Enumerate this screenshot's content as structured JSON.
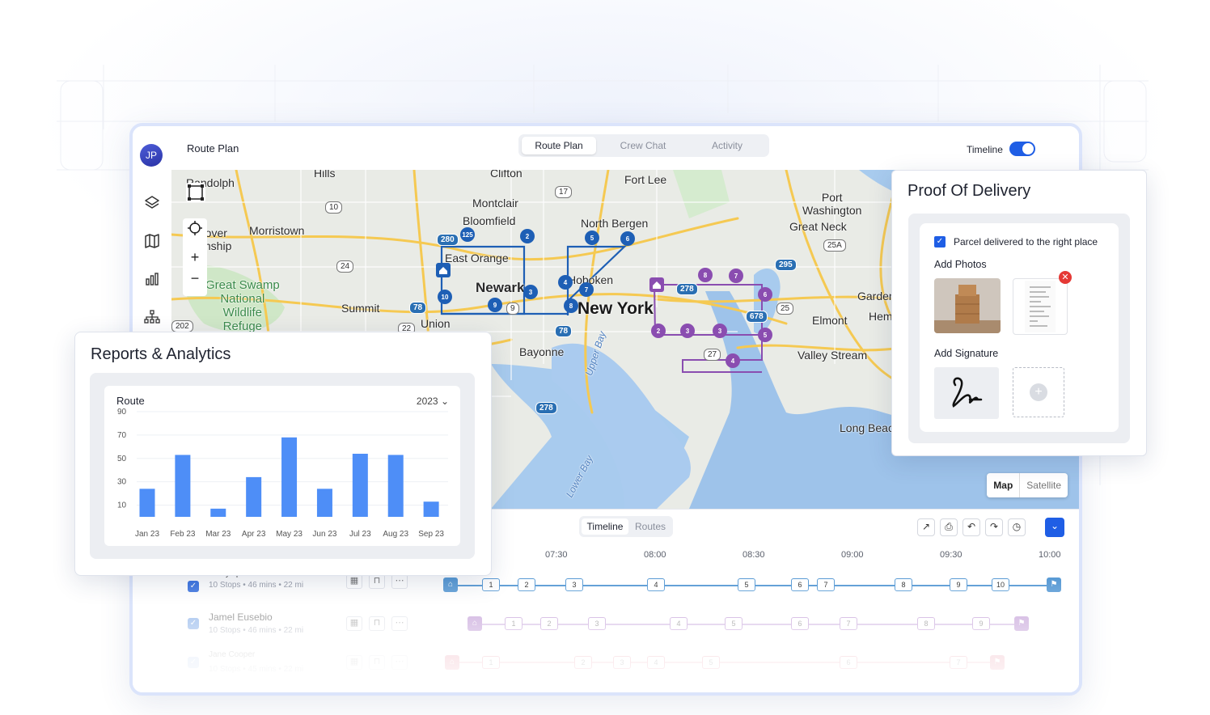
{
  "app": {
    "avatar_initials": "JP",
    "page_title": "Route Plan",
    "tabs": [
      {
        "label": "Route Plan",
        "active": true
      },
      {
        "label": "Crew Chat",
        "active": false
      },
      {
        "label": "Activity",
        "active": false
      }
    ],
    "timeline_toggle": {
      "label": "Timeline",
      "on": true
    },
    "accent_color": "#1f5ee5"
  },
  "rail_icons": [
    "layers-icon",
    "map-icon",
    "analytics-icon",
    "hierarchy-icon"
  ],
  "map": {
    "labels": {
      "randolph": "Randolph",
      "hills": "Hills",
      "clifton": "Clifton",
      "fort_lee": "Fort Lee",
      "port_washington": "Port\nWashington",
      "montclair": "Montclair",
      "bloomfield": "Bloomfield",
      "north_bergen": "North Bergen",
      "great_neck": "Great Neck",
      "hanover": "Hanover\nTownship",
      "morristown": "Morristown",
      "east_orange": "East Orange",
      "newark": "Newark",
      "hoboken": "Hoboken",
      "new_york": "New York",
      "great_swamp": "Great Swamp\nNational\nWildlife\nRefuge",
      "summit": "Summit",
      "union": "Union",
      "bayonne": "Bayonne",
      "garden": "Garden",
      "hempstead": "Hem",
      "elmont": "Elmont",
      "valley_stream": "Valley Stream",
      "long_beach": "Long Beac",
      "upper_bay": "Upper Bay",
      "lower_bay": "Lower Bay"
    },
    "highway_shields": [
      "10",
      "17",
      "24",
      "280",
      "78",
      "9",
      "78",
      "278",
      "25A",
      "295",
      "678",
      "25",
      "278",
      "27",
      "202",
      "22"
    ],
    "blue_route_stops": [
      "125",
      "2",
      "5",
      "6",
      "3",
      "4",
      "7",
      "8",
      "9",
      "10"
    ],
    "purple_route_stops": [
      "8",
      "7",
      "6",
      "2",
      "3",
      "3",
      "5",
      "4"
    ],
    "type_options": [
      {
        "label": "Map",
        "active": true
      },
      {
        "label": "Satellite",
        "active": false
      }
    ]
  },
  "timeline": {
    "view_tabs": [
      {
        "label": "Timeline",
        "active": true
      },
      {
        "label": "Routes",
        "active": false
      }
    ],
    "toolbar_icons": [
      "export-icon",
      "print-icon",
      "undo-icon",
      "redo-icon",
      "history-icon",
      "chevron-down-icon"
    ],
    "times": [
      "07:30",
      "08:00",
      "08:30",
      "09:00",
      "09:30",
      "10:00"
    ],
    "drivers": [
      {
        "name": "Benny Spanbauer",
        "meta": "10 Stops  •  46 mins  •  22 mi",
        "color": "#5a9bd5",
        "stops": [
          "1",
          "2",
          "3",
          "4",
          "5",
          "6",
          "7",
          "8",
          "9",
          "10"
        ]
      },
      {
        "name": "Jamel Eusebio",
        "meta": "10 Stops  •  46 mins  •  22 mi",
        "color": "#c4a0d8",
        "stops": [
          "1",
          "2",
          "3",
          "4",
          "5",
          "6",
          "7",
          "8",
          "9"
        ]
      },
      {
        "name": "Jane Cooper",
        "meta": "10 Stops  •  45 mins  •  22 mi",
        "color": "#f0b5c0",
        "stops": [
          "1",
          "2",
          "3",
          "4",
          "5",
          "6",
          "7"
        ]
      }
    ]
  },
  "reports": {
    "title": "Reports & Analytics",
    "card_title": "Route",
    "year": "2023"
  },
  "chart_data": {
    "type": "bar",
    "title": "Route",
    "categories": [
      "Jan 23",
      "Feb 23",
      "Mar 23",
      "Apr 23",
      "May 23",
      "Jun 23",
      "Jul 23",
      "Aug 23",
      "Sep 23"
    ],
    "values": [
      24,
      53,
      7,
      34,
      68,
      24,
      54,
      53,
      13
    ],
    "y_ticks": [
      10,
      30,
      50,
      70,
      90
    ],
    "ylim": [
      0,
      90
    ],
    "grid": true,
    "color": "#4e8ef7"
  },
  "proof_of_delivery": {
    "title": "Proof Of Delivery",
    "checkbox_label": "Parcel delivered to the right place",
    "checked": true,
    "photos_label": "Add Photos",
    "signature_label": "Add Signature"
  }
}
